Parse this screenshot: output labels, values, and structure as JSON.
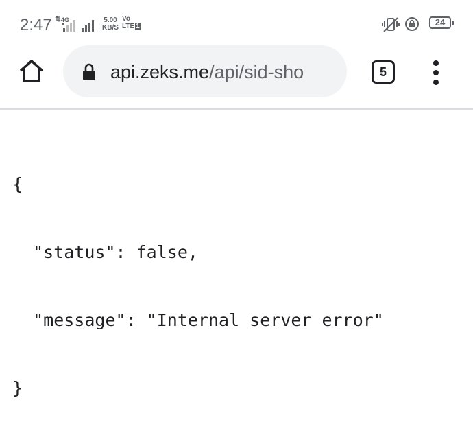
{
  "status_bar": {
    "time": "2:47",
    "network_type": "4G",
    "net_speed_value": "5.00",
    "net_speed_unit": "KB/S",
    "volte_line1": "Vo",
    "volte_line2": "LTE",
    "volte_sim": "1",
    "battery_level": "24"
  },
  "toolbar": {
    "url_domain": "api.zeks.me",
    "url_path": "/api/sid-sho",
    "tab_count": "5"
  },
  "content": {
    "lines": [
      "{",
      "  \"status\": false,",
      "  \"message\": \"Internal server error\"",
      "}"
    ]
  }
}
